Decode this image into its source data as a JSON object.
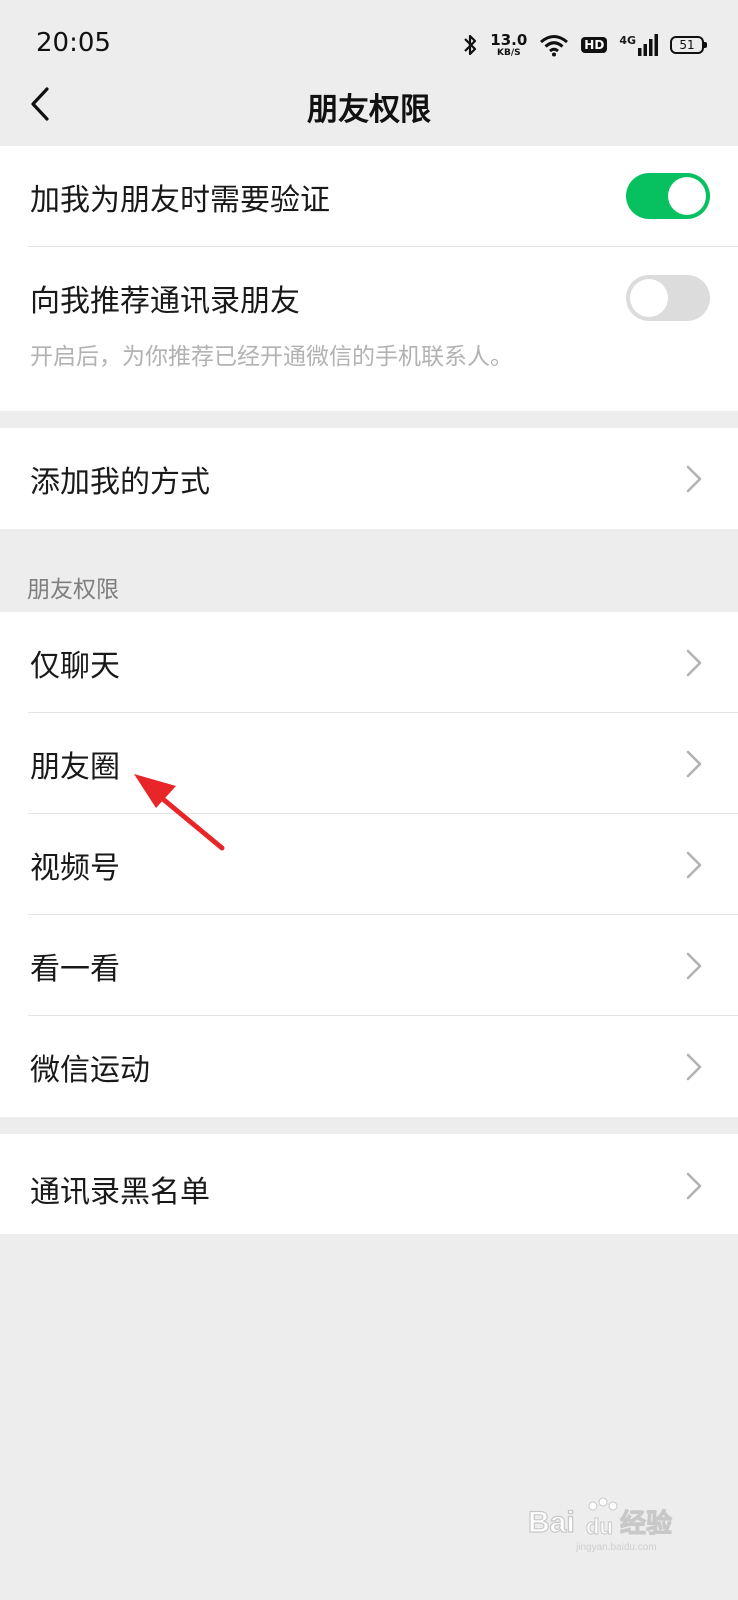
{
  "status_bar": {
    "time": "20:05",
    "net_speed": "13.0",
    "net_unit": "KB/S",
    "hd": "HD",
    "signal": "4G",
    "battery": "51"
  },
  "nav": {
    "title": "朋友权限",
    "back_icon": "chevron-left-icon"
  },
  "section1": {
    "verify_label": "加我为朋友时需要验证",
    "verify_on": true,
    "recommend_label": "向我推荐通讯录朋友",
    "recommend_on": false,
    "recommend_hint": "开启后，为你推荐已经开通微信的手机联系人。"
  },
  "section2": {
    "add_methods_label": "添加我的方式"
  },
  "group_header": "朋友权限",
  "permissions": {
    "items": [
      {
        "label": "仅聊天"
      },
      {
        "label": "朋友圈"
      },
      {
        "label": "视频号"
      },
      {
        "label": "看一看"
      },
      {
        "label": "微信运动"
      }
    ]
  },
  "section4": {
    "blacklist_label": "通讯录黑名单"
  },
  "colors": {
    "accent_green": "#07c160",
    "annotation_red": "#e8262a",
    "background": "#ededed"
  },
  "watermark": {
    "brand": "Baidu经验",
    "url": "jingyan.baidu.com"
  }
}
